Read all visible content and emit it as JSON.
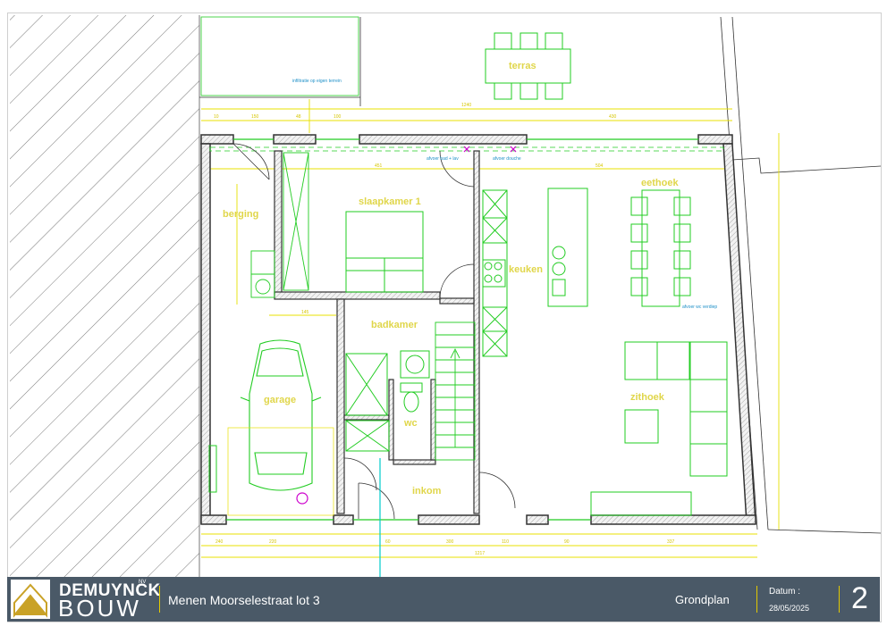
{
  "rooms": {
    "terras": "terras",
    "slaapkamer": "slaapkamer 1",
    "berging": "berging",
    "keuken": "keuken",
    "eethoek": "eethoek",
    "badkamer": "badkamer",
    "garage": "garage",
    "wc": "wc",
    "zithoek": "zithoek",
    "inkom": "inkom"
  },
  "annotations": {
    "infiltratie": "infiltratie op eigen terrein",
    "afvoer_bad": "afvoer bad + lav",
    "afvoer_douche": "afvoer douche",
    "afvoer_wc": "afvoer wc verdiep"
  },
  "titleblock": {
    "brand_top": "DEMUYNCK",
    "brand_nv": "NV",
    "brand_bottom": "BOUW",
    "project": "Menen Moorselestraat lot 3",
    "plan_type": "Grondplan",
    "date_label": "Datum :",
    "date_value": "28/05/2025",
    "page_number": "2"
  },
  "colors": {
    "wall": "#444444",
    "furniture": "#22dd22",
    "dimension": "#e8e000",
    "titlebar": "#4a5967",
    "accent": "#e2c900"
  }
}
